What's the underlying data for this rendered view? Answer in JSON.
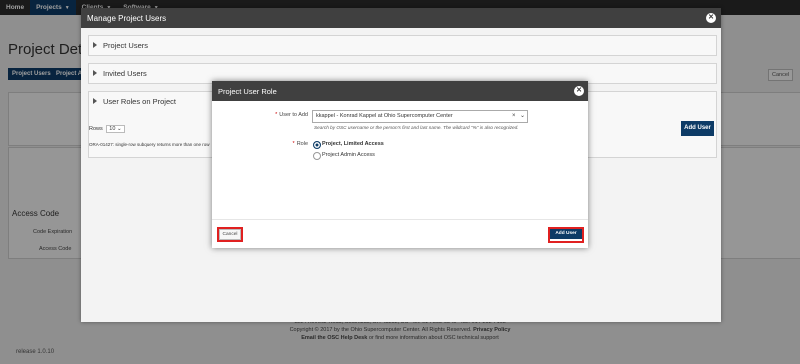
{
  "topnav": {
    "items": [
      {
        "label": "Home"
      },
      {
        "label": "Projects"
      },
      {
        "label": "Clients"
      },
      {
        "label": "Software"
      }
    ]
  },
  "background": {
    "page_title": "Project Details",
    "project_users_tab": "Project Users",
    "project_admins_tab": "Project Administrators",
    "cancel_label": "Cancel",
    "access_code_title": "Access Code",
    "code_expiration_label": "Code Expiration",
    "access_code_label": "Access Code",
    "footer_address": "1224 Kinnear Road, Columbus, OH 43212, US · tel: 614-292-9248 · fax: 614-292-7168",
    "footer_copyright": "Copyright © 2017 by the Ohio Supercomputer Center. All Rights Reserved.",
    "footer_privacy": "Privacy Policy",
    "footer_help_prefix": "Email the OSC Help Desk",
    "footer_help_suffix": "or find more information about OSC technical support",
    "release": "release 1.0.10"
  },
  "manage_dialog": {
    "title": "Manage Project Users",
    "regions": [
      {
        "label": "Project Users"
      },
      {
        "label": "Invited Users"
      },
      {
        "label": "User Roles on Project"
      }
    ],
    "rows_label": "Rows",
    "rows_value": "10",
    "error_text": "ORA-01427: single-row subquery returns more than one row",
    "add_user_label": "Add User"
  },
  "role_dialog": {
    "title": "Project User Role",
    "user_to_add_label": "User to Add",
    "user_to_add_value": "kkappel - Konrad Kappel at Ohio Supercomputer Center",
    "user_hint": "Search by OSC username or the person's first and last name. The wildcard \"%\" is also recognized.",
    "role_label": "Role",
    "role_options": [
      {
        "label": "Project, Limited Access",
        "checked": true
      },
      {
        "label": "Project Admin Access",
        "checked": false
      }
    ],
    "cancel_label": "Cancel",
    "add_user_label": "Add User"
  },
  "colors": {
    "primary": "#0d3b66",
    "header_dark": "#404040",
    "highlight": "#e02020"
  }
}
